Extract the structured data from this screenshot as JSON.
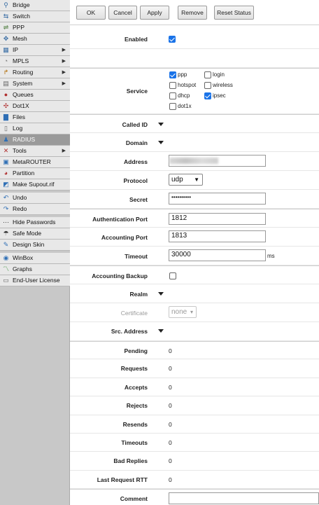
{
  "sidebar": {
    "items": [
      {
        "label": "Bridge",
        "icon": "bridge-icon",
        "glyph": "⚲",
        "color": "#3a6ea5",
        "arrow": false
      },
      {
        "label": "Switch",
        "icon": "switch-icon",
        "glyph": "⇆",
        "color": "#3a6ea5",
        "arrow": false
      },
      {
        "label": "PPP",
        "icon": "ppp-icon",
        "glyph": "⇌",
        "color": "#4a7a3a",
        "arrow": false
      },
      {
        "label": "Mesh",
        "icon": "mesh-icon",
        "glyph": "✥",
        "color": "#3a6ea5",
        "arrow": false
      },
      {
        "label": "IP",
        "icon": "ip-icon",
        "glyph": "▦",
        "color": "#3a6ea5",
        "arrow": true
      },
      {
        "label": "MPLS",
        "icon": "mpls-icon",
        "glyph": "◔",
        "color": "#777",
        "arrow": true
      },
      {
        "label": "Routing",
        "icon": "routing-icon",
        "glyph": "↱",
        "color": "#b06a00",
        "arrow": true
      },
      {
        "label": "System",
        "icon": "system-icon",
        "glyph": "▤",
        "color": "#666",
        "arrow": true
      },
      {
        "label": "Queues",
        "icon": "queues-icon",
        "glyph": "●",
        "color": "#b03030",
        "arrow": false
      },
      {
        "label": "Dot1X",
        "icon": "dot1x-icon",
        "glyph": "✣",
        "color": "#b03030",
        "arrow": false
      },
      {
        "label": "Files",
        "icon": "files-icon",
        "glyph": "▇",
        "color": "#2f6fb5",
        "arrow": false
      },
      {
        "label": "Log",
        "icon": "log-icon",
        "glyph": "▯",
        "color": "#666",
        "arrow": false
      },
      {
        "label": "RADIUS",
        "icon": "radius-icon",
        "glyph": "♟",
        "color": "#2f6fb5",
        "arrow": false,
        "active": true
      },
      {
        "label": "Tools",
        "icon": "tools-icon",
        "glyph": "✕",
        "color": "#b03030",
        "arrow": true
      },
      {
        "label": "MetaROUTER",
        "icon": "metarouter-icon",
        "glyph": "▣",
        "color": "#2f6fb5",
        "arrow": false
      },
      {
        "label": "Partition",
        "icon": "partition-icon",
        "glyph": "◕",
        "color": "#b03030",
        "arrow": false
      },
      {
        "label": "Make Supout.rif",
        "icon": "supout-icon",
        "glyph": "◩",
        "color": "#2f6fb5",
        "arrow": false
      },
      {
        "gap": true
      },
      {
        "label": "Undo",
        "icon": "undo-icon",
        "glyph": "↶",
        "color": "#2f6fb5",
        "arrow": false
      },
      {
        "label": "Redo",
        "icon": "redo-icon",
        "glyph": "↷",
        "color": "#2f6fb5",
        "arrow": false
      },
      {
        "gap": true
      },
      {
        "label": "Hide Passwords",
        "icon": "hide-passwords-icon",
        "glyph": "⋯",
        "color": "#333",
        "arrow": false
      },
      {
        "label": "Safe Mode",
        "icon": "safe-mode-icon",
        "glyph": "☂",
        "color": "#333",
        "arrow": false
      },
      {
        "label": "Design Skin",
        "icon": "design-skin-icon",
        "glyph": "✎",
        "color": "#2f6fb5",
        "arrow": false
      },
      {
        "gap": true
      },
      {
        "label": "WinBox",
        "icon": "winbox-icon",
        "glyph": "◉",
        "color": "#2f6fb5",
        "arrow": false
      },
      {
        "label": "Graphs",
        "icon": "graphs-icon",
        "glyph": "〽",
        "color": "#2f8a2f",
        "arrow": false
      },
      {
        "label": "End-User License",
        "icon": "license-icon",
        "glyph": "▭",
        "color": "#666",
        "arrow": false
      }
    ]
  },
  "toolbar": {
    "ok": "OK",
    "cancel": "Cancel",
    "apply": "Apply",
    "remove": "Remove",
    "reset_status": "Reset Status"
  },
  "form": {
    "enabled": {
      "label": "Enabled",
      "checked": true
    },
    "service": {
      "label": "Service",
      "options": [
        {
          "label": "ppp",
          "checked": true
        },
        {
          "label": "login",
          "checked": false
        },
        {
          "label": "hotspot",
          "checked": false
        },
        {
          "label": "wireless",
          "checked": false
        },
        {
          "label": "dhcp",
          "checked": false
        },
        {
          "label": "ipsec",
          "checked": true
        },
        {
          "label": "dot1x",
          "checked": false
        }
      ]
    },
    "called_id": {
      "label": "Called ID"
    },
    "domain": {
      "label": "Domain"
    },
    "address": {
      "label": "Address",
      "value": ""
    },
    "protocol": {
      "label": "Protocol",
      "value": "udp"
    },
    "secret": {
      "label": "Secret",
      "value": "••••••••••"
    },
    "auth_port": {
      "label": "Authentication Port",
      "value": "1812"
    },
    "acct_port": {
      "label": "Accounting Port",
      "value": "1813"
    },
    "timeout": {
      "label": "Timeout",
      "value": "30000",
      "unit": "ms"
    },
    "acct_backup": {
      "label": "Accounting Backup",
      "checked": false
    },
    "realm": {
      "label": "Realm"
    },
    "certificate": {
      "label": "Certificate",
      "value": "none"
    },
    "src_address": {
      "label": "Src. Address"
    },
    "stats": [
      {
        "label": "Pending",
        "value": "0"
      },
      {
        "label": "Requests",
        "value": "0"
      },
      {
        "label": "Accepts",
        "value": "0"
      },
      {
        "label": "Rejects",
        "value": "0"
      },
      {
        "label": "Resends",
        "value": "0"
      },
      {
        "label": "Timeouts",
        "value": "0"
      },
      {
        "label": "Bad Replies",
        "value": "0"
      },
      {
        "label": "Last Request RTT",
        "value": "0"
      }
    ],
    "comment": {
      "label": "Comment",
      "value": ""
    }
  }
}
